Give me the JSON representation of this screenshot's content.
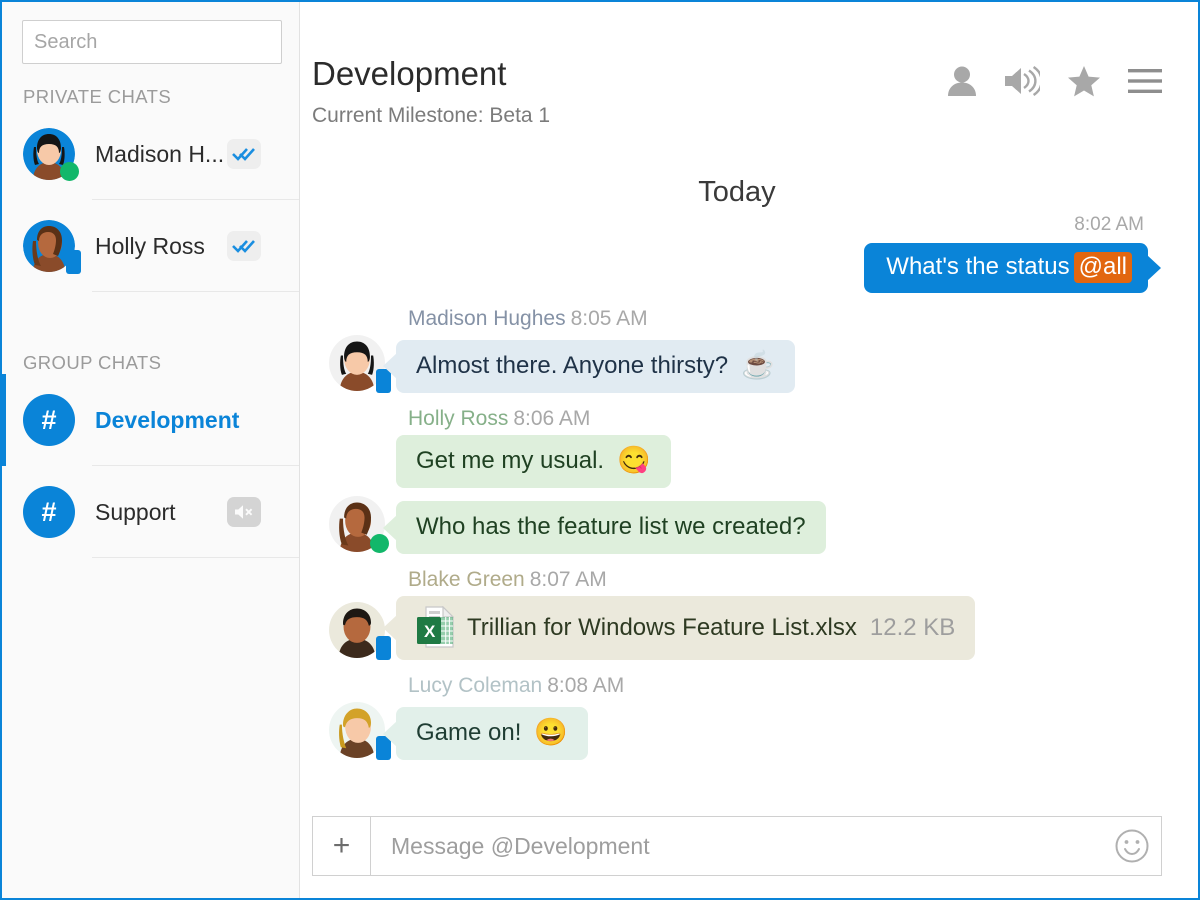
{
  "search": {
    "placeholder": "Search",
    "value": ""
  },
  "sidebar": {
    "private_label": "PRIVATE CHATS",
    "group_label": "GROUP CHATS",
    "private_chats": [
      {
        "name": "Madison H...",
        "badge": "double-check",
        "presence": "online",
        "avatar": "madison"
      },
      {
        "name": "Holly Ross",
        "badge": "double-check",
        "presence": "mobile",
        "avatar": "holly"
      }
    ],
    "group_chats": [
      {
        "name": "Development",
        "glyph": "#",
        "active": true,
        "badge": ""
      },
      {
        "name": "Support",
        "glyph": "#",
        "active": false,
        "badge": "muted"
      }
    ]
  },
  "header": {
    "title": "Development",
    "subtitle": "Current Milestone: Beta 1",
    "icons": [
      "contact-icon",
      "volume-icon",
      "star-icon",
      "menu-icon"
    ]
  },
  "conversation": {
    "date_divider": "Today",
    "outgoing": {
      "time": "8:02 AM",
      "text": "What's the status",
      "mention": "@all"
    },
    "messages": [
      {
        "sender": "Madison Hughes",
        "time": "8:05 AM",
        "name_color": "#8592a6",
        "avatar": "madison",
        "presence": "mobile",
        "bubbles": [
          {
            "text": "Almost there. Anyone thirsty?",
            "emoji": "☕",
            "bg": "#e1ebf2",
            "fg": "#1f3247",
            "tail": true
          }
        ]
      },
      {
        "sender": "Holly Ross",
        "time": "8:06 AM",
        "name_color": "#86b089",
        "avatar": "holly",
        "presence": "online",
        "bubbles": [
          {
            "text": "Get me my usual.",
            "emoji": "😋",
            "bg": "#deefdc",
            "fg": "#1f4122",
            "tail": false
          },
          {
            "text": "Who has the feature list we created?",
            "emoji": "",
            "bg": "#deefdc",
            "fg": "#1f4122",
            "tail": true
          }
        ]
      },
      {
        "sender": "Blake Green",
        "time": "8:07 AM",
        "name_color": "#b0ab8a",
        "avatar": "blake",
        "presence": "mobile",
        "bubbles": [
          {
            "file_name": "Trillian for Windows Feature List.xlsx",
            "file_size": "12.2 KB",
            "file_icon": "excel-icon",
            "bg": "#ebe9dc",
            "fg": "#2e3a22",
            "tail": true
          }
        ]
      },
      {
        "sender": "Lucy Coleman",
        "time": "8:08 AM",
        "name_color": "#b2c2c6",
        "avatar": "lucy",
        "presence": "mobile",
        "bubbles": [
          {
            "text": "Game on!",
            "emoji": "😀",
            "bg": "#e2f0ea",
            "fg": "#1f3d33",
            "tail": true
          }
        ]
      }
    ]
  },
  "composer": {
    "add_label": "+",
    "placeholder": "Message @Development",
    "value": "",
    "emoji_button": "smiley-icon"
  },
  "colors": {
    "accent": "#0a84d8",
    "mention": "#e2660f",
    "online": "#12b76a"
  }
}
